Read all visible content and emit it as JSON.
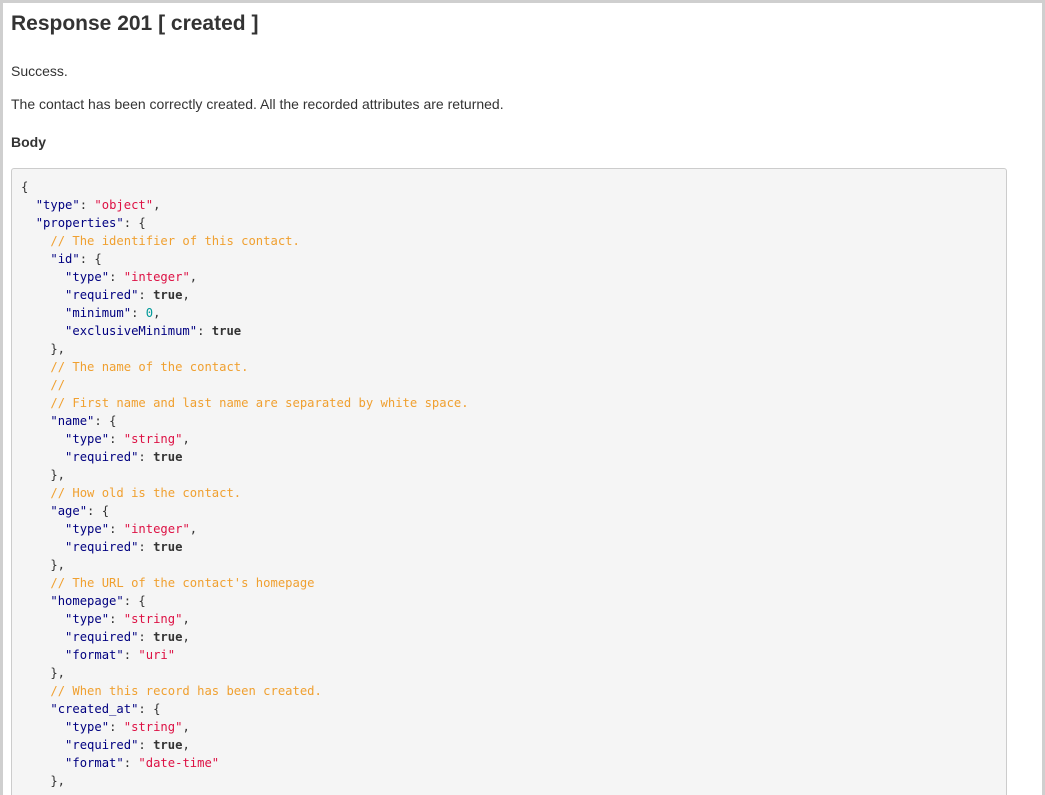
{
  "page": {
    "heading": "Response 201 [ created ]",
    "status_text": "Success.",
    "description": "The contact has been correctly created. All the recorded attributes are returned.",
    "body_label": "Body"
  },
  "code_lines": [
    [
      [
        "p",
        "{"
      ]
    ],
    [
      [
        "p",
        "  "
      ],
      [
        "k",
        "\"type\""
      ],
      [
        "p",
        ": "
      ],
      [
        "s",
        "\"object\""
      ],
      [
        "p",
        ","
      ]
    ],
    [
      [
        "p",
        "  "
      ],
      [
        "k",
        "\"properties\""
      ],
      [
        "p",
        ": {"
      ]
    ],
    [
      [
        "p",
        "    "
      ],
      [
        "c",
        "// The identifier of this contact."
      ]
    ],
    [
      [
        "p",
        "    "
      ],
      [
        "k",
        "\"id\""
      ],
      [
        "p",
        ": {"
      ]
    ],
    [
      [
        "p",
        "      "
      ],
      [
        "k",
        "\"type\""
      ],
      [
        "p",
        ": "
      ],
      [
        "s",
        "\"integer\""
      ],
      [
        "p",
        ","
      ]
    ],
    [
      [
        "p",
        "      "
      ],
      [
        "k",
        "\"required\""
      ],
      [
        "p",
        ": "
      ],
      [
        "b",
        "true"
      ],
      [
        "p",
        ","
      ]
    ],
    [
      [
        "p",
        "      "
      ],
      [
        "k",
        "\"minimum\""
      ],
      [
        "p",
        ": "
      ],
      [
        "n",
        "0"
      ],
      [
        "p",
        ","
      ]
    ],
    [
      [
        "p",
        "      "
      ],
      [
        "k",
        "\"exclusiveMinimum\""
      ],
      [
        "p",
        ": "
      ],
      [
        "b",
        "true"
      ]
    ],
    [
      [
        "p",
        "    },"
      ]
    ],
    [
      [
        "p",
        "    "
      ],
      [
        "c",
        "// The name of the contact."
      ]
    ],
    [
      [
        "p",
        "    "
      ],
      [
        "c",
        "//"
      ]
    ],
    [
      [
        "p",
        "    "
      ],
      [
        "c",
        "// First name and last name are separated by white space."
      ]
    ],
    [
      [
        "p",
        "    "
      ],
      [
        "k",
        "\"name\""
      ],
      [
        "p",
        ": {"
      ]
    ],
    [
      [
        "p",
        "      "
      ],
      [
        "k",
        "\"type\""
      ],
      [
        "p",
        ": "
      ],
      [
        "s",
        "\"string\""
      ],
      [
        "p",
        ","
      ]
    ],
    [
      [
        "p",
        "      "
      ],
      [
        "k",
        "\"required\""
      ],
      [
        "p",
        ": "
      ],
      [
        "b",
        "true"
      ]
    ],
    [
      [
        "p",
        "    },"
      ]
    ],
    [
      [
        "p",
        "    "
      ],
      [
        "c",
        "// How old is the contact."
      ]
    ],
    [
      [
        "p",
        "    "
      ],
      [
        "k",
        "\"age\""
      ],
      [
        "p",
        ": {"
      ]
    ],
    [
      [
        "p",
        "      "
      ],
      [
        "k",
        "\"type\""
      ],
      [
        "p",
        ": "
      ],
      [
        "s",
        "\"integer\""
      ],
      [
        "p",
        ","
      ]
    ],
    [
      [
        "p",
        "      "
      ],
      [
        "k",
        "\"required\""
      ],
      [
        "p",
        ": "
      ],
      [
        "b",
        "true"
      ]
    ],
    [
      [
        "p",
        "    },"
      ]
    ],
    [
      [
        "p",
        "    "
      ],
      [
        "c",
        "// The URL of the contact's homepage"
      ]
    ],
    [
      [
        "p",
        "    "
      ],
      [
        "k",
        "\"homepage\""
      ],
      [
        "p",
        ": {"
      ]
    ],
    [
      [
        "p",
        "      "
      ],
      [
        "k",
        "\"type\""
      ],
      [
        "p",
        ": "
      ],
      [
        "s",
        "\"string\""
      ],
      [
        "p",
        ","
      ]
    ],
    [
      [
        "p",
        "      "
      ],
      [
        "k",
        "\"required\""
      ],
      [
        "p",
        ": "
      ],
      [
        "b",
        "true"
      ],
      [
        "p",
        ","
      ]
    ],
    [
      [
        "p",
        "      "
      ],
      [
        "k",
        "\"format\""
      ],
      [
        "p",
        ": "
      ],
      [
        "s",
        "\"uri\""
      ]
    ],
    [
      [
        "p",
        "    },"
      ]
    ],
    [
      [
        "p",
        "    "
      ],
      [
        "c",
        "// When this record has been created."
      ]
    ],
    [
      [
        "p",
        "    "
      ],
      [
        "k",
        "\"created_at\""
      ],
      [
        "p",
        ": {"
      ]
    ],
    [
      [
        "p",
        "      "
      ],
      [
        "k",
        "\"type\""
      ],
      [
        "p",
        ": "
      ],
      [
        "s",
        "\"string\""
      ],
      [
        "p",
        ","
      ]
    ],
    [
      [
        "p",
        "      "
      ],
      [
        "k",
        "\"required\""
      ],
      [
        "p",
        ": "
      ],
      [
        "b",
        "true"
      ],
      [
        "p",
        ","
      ]
    ],
    [
      [
        "p",
        "      "
      ],
      [
        "k",
        "\"format\""
      ],
      [
        "p",
        ": "
      ],
      [
        "s",
        "\"date-time\""
      ]
    ],
    [
      [
        "p",
        "    },"
      ]
    ]
  ]
}
